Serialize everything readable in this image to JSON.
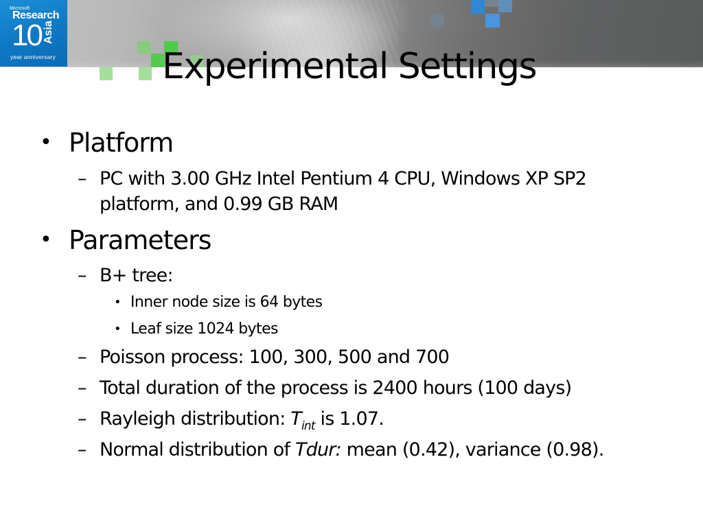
{
  "logo": {
    "company": "Microsoft",
    "name": "Research",
    "number": "10",
    "region": "Asia",
    "tagline": "year anniversary",
    "brand_color": "#0f79c6"
  },
  "decor": {
    "green_accent": "#4fc94a",
    "blue_accent": "#3b8fe0"
  },
  "slide": {
    "title": "Experimental Settings",
    "sections": [
      {
        "heading": "Platform",
        "items": [
          {
            "text": "PC with 3.00 GHz Intel Pentium 4 CPU, Windows XP SP2 platform, and 0.99 GB RAM"
          }
        ]
      },
      {
        "heading": "Parameters",
        "items": [
          {
            "text": "B+ tree:",
            "subitems": [
              "Inner node size is 64 bytes",
              "Leaf size 1024 bytes"
            ]
          },
          {
            "text": "Poisson process: 100, 300, 500 and 700"
          },
          {
            "text": "Total duration of the process is 2400 hours (100 days)"
          },
          {
            "prefix": "Rayleigh distribution: ",
            "var": "T",
            "var_sub": "int",
            "suffix": " is 1.07."
          },
          {
            "prefix": "Normal distribution of ",
            "var": "Tdur:",
            "suffix": " mean (0.42), variance (0.98)."
          }
        ]
      }
    ],
    "bullet_glyph": "•",
    "dash_glyph": "–"
  }
}
